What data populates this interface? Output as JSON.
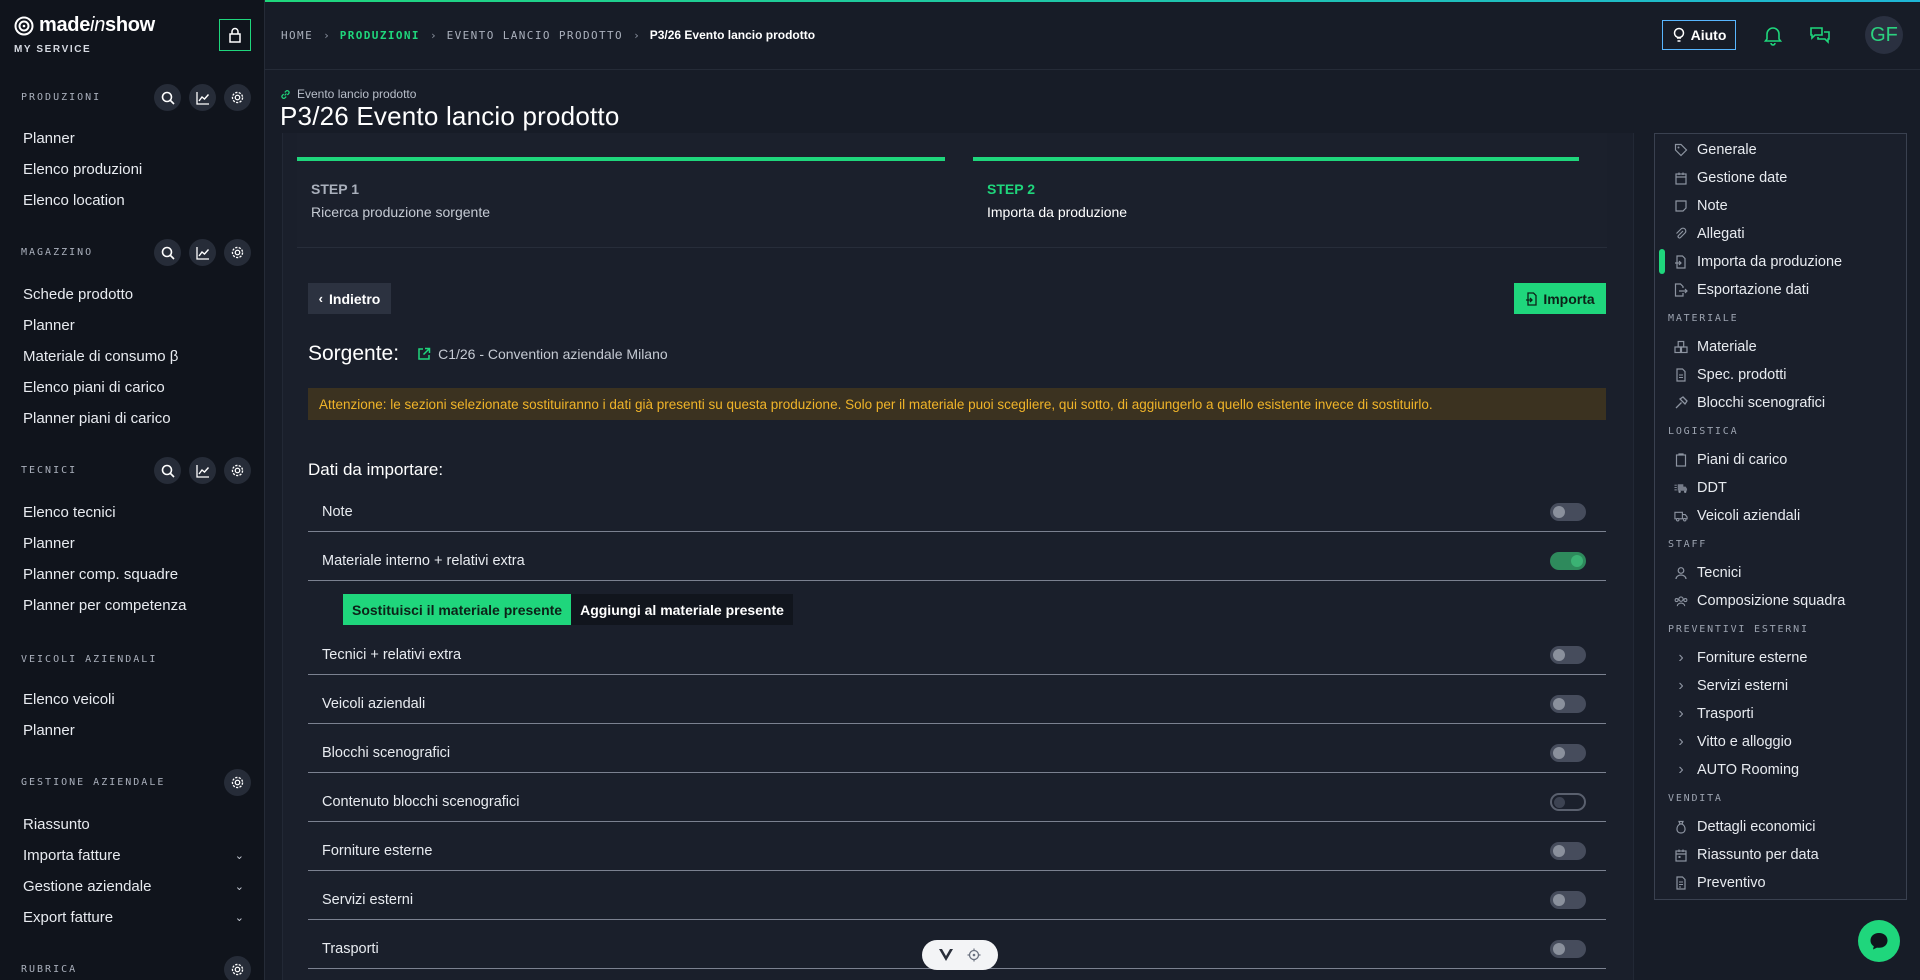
{
  "brand": {
    "name_part1": "made",
    "name_part2": "in",
    "name_part3": "show",
    "subtitle": "MY SERVICE"
  },
  "sidebar": {
    "sections": [
      {
        "title": "PRODUZIONI",
        "items": [
          "Planner",
          "Elenco produzioni",
          "Elenco location"
        ]
      },
      {
        "title": "MAGAZZINO",
        "items": [
          "Schede prodotto",
          "Planner",
          "Materiale di consumo β",
          "Elenco piani di carico",
          "Planner piani di carico"
        ]
      },
      {
        "title": "TECNICI",
        "items": [
          "Elenco tecnici",
          "Planner",
          "Planner comp. squadre",
          "Planner per competenza"
        ]
      },
      {
        "title": "VEICOLI AZIENDALI",
        "items": [
          "Elenco veicoli",
          "Planner"
        ]
      },
      {
        "title": "GESTIONE AZIENDALE",
        "items": [
          "Riassunto",
          "Importa fatture",
          "Gestione aziendale",
          "Export fatture"
        ]
      },
      {
        "title": "RUBRICA",
        "items": []
      }
    ]
  },
  "topbar": {
    "breadcrumb": [
      "HOME",
      "PRODUZIONI",
      "EVENTO LANCIO PRODOTTO",
      "P3/26 Evento lancio prodotto"
    ],
    "help_label": "Aiuto",
    "avatar_initials": "GF"
  },
  "page": {
    "parent_link": "Evento lancio prodotto",
    "title": "P3/26 Evento lancio prodotto"
  },
  "stepper": [
    {
      "label": "STEP 1",
      "desc": "Ricerca produzione sorgente"
    },
    {
      "label": "STEP 2",
      "desc": "Importa da produzione"
    }
  ],
  "actions": {
    "back": "Indietro",
    "import": "Importa"
  },
  "source": {
    "label": "Sorgente:",
    "value": "C1/26 - Convention aziendale Milano"
  },
  "warning": "Attenzione: le sezioni selezionate sostituiranno i dati già presenti su questa produzione. Solo per il materiale puoi scegliere, qui sotto, di aggiungerlo a quello esistente invece di sostituirlo.",
  "import_section": {
    "title": "Dati da importare:",
    "options": [
      {
        "label": "Note",
        "checked": false
      },
      {
        "label": "Materiale interno + relativi extra",
        "checked": true
      },
      {
        "label": "Tecnici + relativi extra",
        "checked": false
      },
      {
        "label": "Veicoli aziendali",
        "checked": false
      },
      {
        "label": "Blocchi scenografici",
        "checked": false
      },
      {
        "label": "Contenuto blocchi scenografici",
        "checked": false
      },
      {
        "label": "Forniture esterne",
        "checked": false
      },
      {
        "label": "Servizi esterni",
        "checked": false
      },
      {
        "label": "Trasporti",
        "checked": false
      }
    ],
    "material_mode": {
      "replace": "Sostituisci il materiale presente",
      "add": "Aggiungi al materiale presente",
      "selected": "replace"
    }
  },
  "right_menu": {
    "items_top": [
      {
        "label": "Generale",
        "icon": "tag-icon"
      },
      {
        "label": "Gestione date",
        "icon": "calendar-icon"
      },
      {
        "label": "Note",
        "icon": "note-icon"
      },
      {
        "label": "Allegati",
        "icon": "paperclip-icon"
      },
      {
        "label": "Importa da produzione",
        "icon": "file-import-icon"
      },
      {
        "label": "Esportazione dati",
        "icon": "file-export-icon"
      }
    ],
    "materiale_title": "MATERIALE",
    "materiale": [
      {
        "label": "Materiale",
        "icon": "boxes-icon"
      },
      {
        "label": "Spec. prodotti",
        "icon": "document-icon"
      },
      {
        "label": "Blocchi scenografici",
        "icon": "hammer-icon"
      }
    ],
    "logistica_title": "LOGISTICA",
    "logistica": [
      {
        "label": "Piani di carico",
        "icon": "clipboard-icon"
      },
      {
        "label": "DDT",
        "icon": "truck-fast-icon"
      },
      {
        "label": "Veicoli aziendali",
        "icon": "truck-icon"
      }
    ],
    "staff_title": "STAFF",
    "staff": [
      {
        "label": "Tecnici",
        "icon": "user-icon"
      },
      {
        "label": "Composizione squadra",
        "icon": "team-icon"
      }
    ],
    "preventivi_title": "PREVENTIVI ESTERNI",
    "preventivi": [
      {
        "label": "Forniture esterne",
        "icon": "chevron-right-icon"
      },
      {
        "label": "Servizi esterni",
        "icon": "chevron-right-icon"
      },
      {
        "label": "Trasporti",
        "icon": "chevron-right-icon"
      },
      {
        "label": "Vitto e alloggio",
        "icon": "chevron-right-icon"
      },
      {
        "label": "AUTO Rooming",
        "icon": "chevron-right-icon"
      }
    ],
    "vendita_title": "VENDITA",
    "vendita": [
      {
        "label": "Dettagli economici",
        "icon": "money-bag-icon"
      },
      {
        "label": "Riassunto per data",
        "icon": "calendar-summary-icon"
      },
      {
        "label": "Preventivo",
        "icon": "invoice-icon"
      }
    ]
  },
  "colors": {
    "accent": "#1fd67c",
    "warning_bg": "#3b3220",
    "warning_text": "#f0b429",
    "background": "#171c27",
    "sidebar": "#10141c"
  }
}
